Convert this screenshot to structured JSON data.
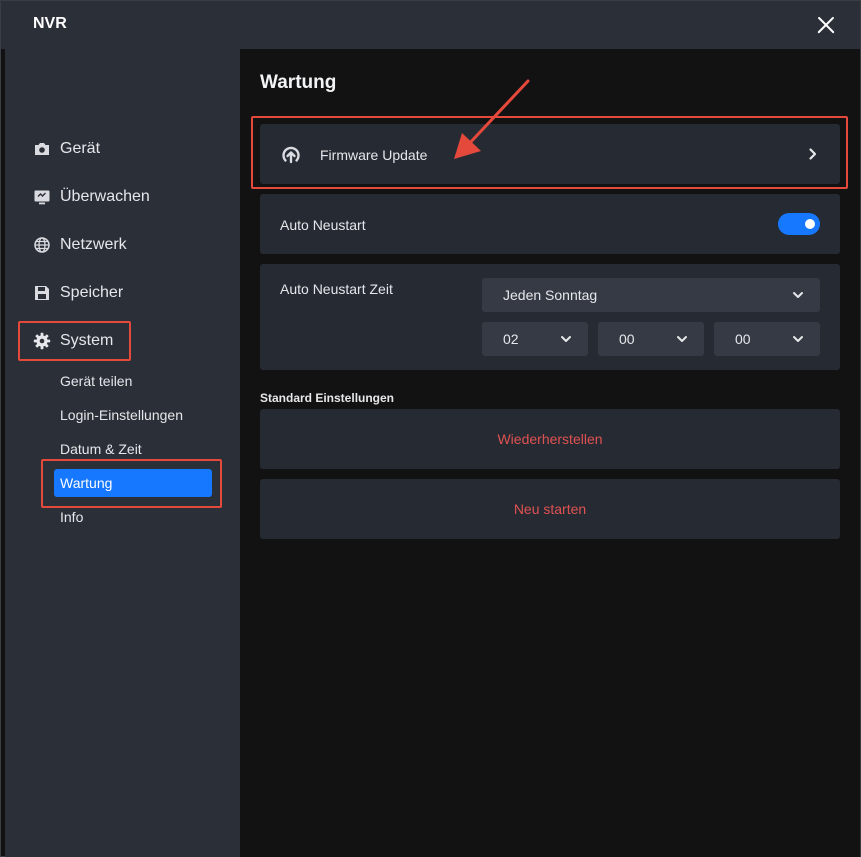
{
  "window": {
    "title": "NVR"
  },
  "sidebar": {
    "items": [
      {
        "label": "Gerät",
        "icon": "camera-icon"
      },
      {
        "label": "Überwachen",
        "icon": "monitor-icon"
      },
      {
        "label": "Netzwerk",
        "icon": "globe-icon"
      },
      {
        "label": "Speicher",
        "icon": "floppy-disk-icon"
      },
      {
        "label": "System",
        "icon": "gear-icon"
      }
    ],
    "system_subitems": [
      {
        "label": "Gerät teilen"
      },
      {
        "label": "Login-Einstellungen"
      },
      {
        "label": "Datum & Zeit"
      },
      {
        "label": "Wartung",
        "active": true
      },
      {
        "label": "Info"
      }
    ]
  },
  "main": {
    "title": "Wartung",
    "firmware": {
      "label": "Firmware Update",
      "icon": "upload-cloud-icon"
    },
    "auto_restart": {
      "label": "Auto Neustart",
      "enabled": true
    },
    "auto_restart_time": {
      "label": "Auto Neustart Zeit",
      "day": "Jeden Sonntag",
      "hour": "02",
      "minute": "00",
      "second": "00"
    },
    "defaults": {
      "section_label": "Standard Einstellungen",
      "restore_label": "Wiederherstellen",
      "restart_label": "Neu starten"
    }
  },
  "colors": {
    "accent": "#1677ff",
    "highlight": "#e5493c",
    "danger_text": "#e05252",
    "panel": "#2b2f38",
    "card": "#262a33"
  }
}
